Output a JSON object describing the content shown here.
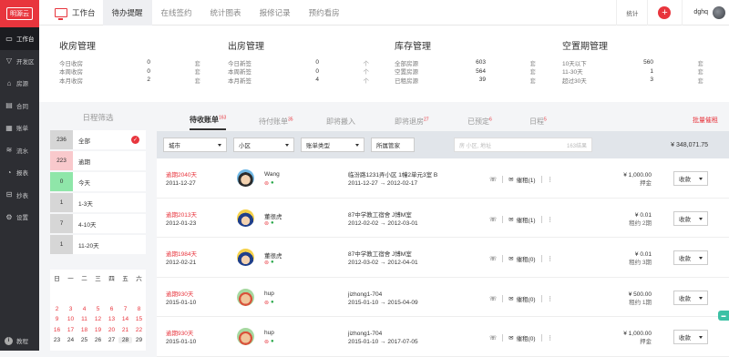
{
  "app": {
    "logo": "明源云"
  },
  "sidebar": {
    "items": [
      {
        "label": "工作台",
        "icon": "monitor-icon",
        "glyph": "▭"
      },
      {
        "label": "开发区",
        "icon": "filter-icon",
        "glyph": "▽"
      },
      {
        "label": "房源",
        "icon": "house-icon",
        "glyph": "⌂"
      },
      {
        "label": "合同",
        "icon": "contract-icon",
        "glyph": "▤"
      },
      {
        "label": "账单",
        "icon": "bill-icon",
        "glyph": "▦"
      },
      {
        "label": "流水",
        "icon": "flow-icon",
        "glyph": "≋"
      },
      {
        "label": "报表",
        "icon": "report-icon",
        "glyph": "◔"
      },
      {
        "label": "抄表",
        "icon": "meter-icon",
        "glyph": "⊟"
      },
      {
        "label": "设置",
        "icon": "gear-icon",
        "glyph": "⚙"
      }
    ],
    "bottom_label": "教程"
  },
  "topbar": {
    "home_label": "工作台",
    "tabs": [
      "待办提醒",
      "在线签约",
      "统计图表",
      "报修记录",
      "预约看房"
    ],
    "stat_label": "统计",
    "user": "dghq"
  },
  "stats": [
    {
      "title": "收房管理",
      "rows": [
        [
          "今日收房",
          "0",
          "套"
        ],
        [
          "本周收房",
          "0",
          "套"
        ],
        [
          "本月收房",
          "2",
          "套"
        ]
      ]
    },
    {
      "title": "出房管理",
      "rows": [
        [
          "今日新签",
          "0",
          "个"
        ],
        [
          "本周新签",
          "0",
          "个"
        ],
        [
          "本月新签",
          "4",
          "个"
        ]
      ]
    },
    {
      "title": "库存管理",
      "rows": [
        [
          "全部房源",
          "603",
          "套"
        ],
        [
          "空置房源",
          "564",
          "套"
        ],
        [
          "已租房源",
          "39",
          "套"
        ]
      ]
    },
    {
      "title": "空置期管理",
      "rows": [
        [
          "10天以下",
          "560",
          "套"
        ],
        [
          "11-30天",
          "1",
          "套"
        ],
        [
          "超过30天",
          "3",
          "套"
        ]
      ]
    }
  ],
  "filter": {
    "heading": "日程筛选",
    "items": [
      {
        "count": "236",
        "label": "全部",
        "bg": "#d6d6d6",
        "checked": true
      },
      {
        "count": "223",
        "label": "逾期",
        "bg": "#f9c9cc",
        "checked": false
      },
      {
        "count": "0",
        "label": "今天",
        "bg": "#8fe6a9",
        "checked": false
      },
      {
        "count": "1",
        "label": "1-3天",
        "bg": "#d6d6d6",
        "checked": false
      },
      {
        "count": "7",
        "label": "4-10天",
        "bg": "#d6d6d6",
        "checked": false
      },
      {
        "count": "1",
        "label": "11-20天",
        "bg": "#d6d6d6",
        "checked": false
      }
    ]
  },
  "calendar": {
    "weekdays": [
      "日",
      "一",
      "二",
      "三",
      "四",
      "五",
      "六"
    ],
    "weeks": [
      [
        "",
        "",
        "",
        "",
        "",
        "",
        ""
      ],
      [
        "",
        "",
        "",
        "",
        "",
        "",
        ""
      ],
      [
        "2",
        "3",
        "4",
        "5",
        "6",
        "7",
        "8"
      ],
      [
        "9",
        "10",
        "11",
        "12",
        "13",
        "14",
        "15"
      ],
      [
        "16",
        "17",
        "18",
        "19",
        "20",
        "21",
        "22"
      ],
      [
        "23",
        "24",
        "25",
        "26",
        "27",
        "28",
        "29"
      ]
    ]
  },
  "main_tabs": [
    {
      "label": "待收账单",
      "count": "163"
    },
    {
      "label": "待付账单",
      "count": "35"
    },
    {
      "label": "即将搬入",
      "count": ""
    },
    {
      "label": "即将退房",
      "count": "27"
    },
    {
      "label": "已预定",
      "count": "6"
    },
    {
      "label": "日程",
      "count": "5"
    }
  ],
  "batch_label": "批量催租",
  "toolbar": {
    "city": "城市",
    "district": "小区",
    "bill_type": "账单类型",
    "owner": "所属管家",
    "search_placeholder": "房 小区, 地址",
    "result_count": "163结果",
    "total": "¥ 348,071.75"
  },
  "bills": [
    {
      "status": "逾期2040天",
      "date": "2011-12-27",
      "name": "Wang",
      "addr": "临汾路1231弄小区 1幢2单元3室 B",
      "period": "2011-12-27 → 2012-02-17",
      "remind": "催租(1)",
      "amount": "¥ 1,000.00",
      "kind": "押金",
      "action": "收款",
      "avatar": "boy"
    },
    {
      "status": "逾期2013天",
      "date": "2012-01-23",
      "name": "董很虎",
      "addr": "87中学教工宿舍 J博M室",
      "period": "2012-02-02 → 2012-03-01",
      "remind": "催租(1)",
      "amount": "¥ 0.01",
      "kind": "租约 2期",
      "action": "收款",
      "avatar": "police"
    },
    {
      "status": "逾期1984天",
      "date": "2012-02-21",
      "name": "董很虎",
      "addr": "87中学教工宿舍 J博M室",
      "period": "2012-03-02 → 2012-04-01",
      "remind": "催租(0)",
      "amount": "¥ 0.01",
      "kind": "租约 3期",
      "action": "收款",
      "avatar": "police"
    },
    {
      "status": "逾期930天",
      "date": "2015-01-10",
      "name": "hup",
      "addr": "jizhong1-704",
      "period": "2015-01-10 → 2015-04-09",
      "remind": "催租(0)",
      "amount": "¥ 500.00",
      "kind": "租约 1期",
      "action": "收款",
      "avatar": "elder"
    },
    {
      "status": "逾期930天",
      "date": "2015-01-10",
      "name": "hup",
      "addr": "jizhong1-704",
      "period": "2015-01-10 → 2017-07-05",
      "remind": "催租(0)",
      "amount": "¥ 1,000.00",
      "kind": "押金",
      "action": "收款",
      "avatar": "elder"
    }
  ],
  "chat_label": "客服"
}
